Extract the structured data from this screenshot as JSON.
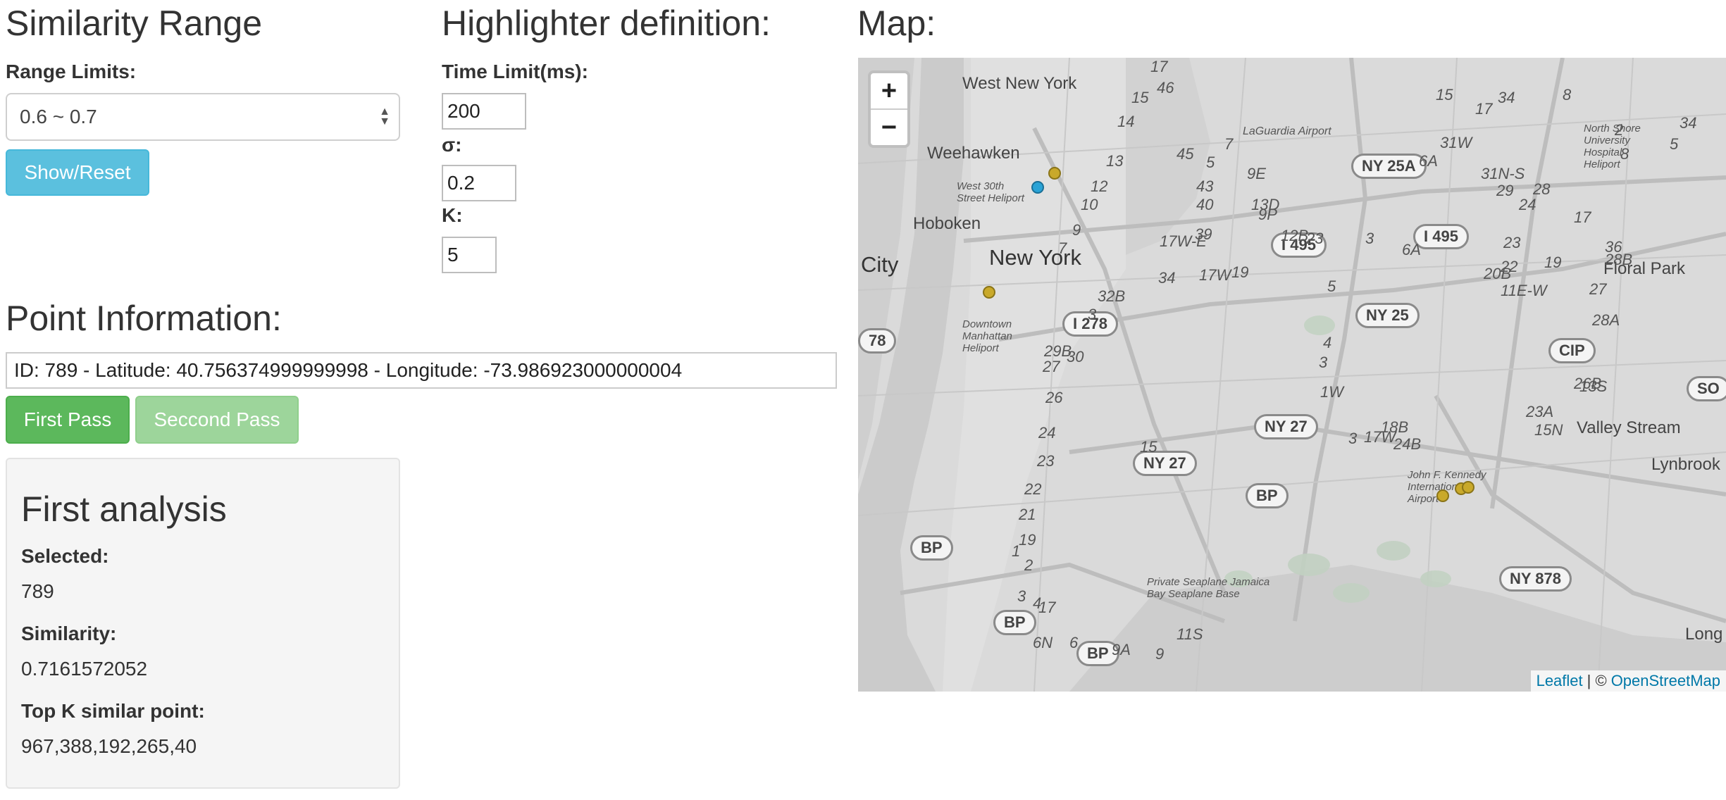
{
  "similarity": {
    "title": "Similarity Range",
    "range_label": "Range Limits:",
    "range_value": "0.6 ~ 0.7",
    "show_reset": "Show/Reset"
  },
  "highlighter": {
    "title": "Highlighter definition:",
    "time_label": "Time Limit(ms):",
    "time_value": "200",
    "sigma_label": "σ:",
    "sigma_value": "0.2",
    "k_label": "K:",
    "k_value": "5"
  },
  "point_info": {
    "title": "Point Information:",
    "text": "ID: 789 - Latitude: 40.756374999999998 - Longitude: -73.986923000000004",
    "first_pass": "First Pass",
    "second_pass": "Seccond Pass"
  },
  "analysis": {
    "title": "First analysis",
    "selected_label": "Selected:",
    "selected_value": "789",
    "similarity_label": "Similarity:",
    "similarity_value": "0.7161572052",
    "topk_label": "Top K similar point:",
    "topk_value": "967,388,192,265,40"
  },
  "map": {
    "title": "Map:",
    "zoom_in": "+",
    "zoom_out": "−",
    "attribution_leaflet": "Leaflet",
    "attribution_sep": "| ©",
    "attribution_osm": "OpenStreetMap",
    "places": {
      "west_new_york": "West New York",
      "weehawken": "Weehawken",
      "hoboken": "Hoboken",
      "city": "City",
      "new_york": "New York",
      "floral_park": "Floral Park",
      "valley_stream": "Valley Stream",
      "lynbrook": "Lynbrook",
      "long_beach": "Long Beac",
      "laguardia": "LaGuardia Airport",
      "jfk": "John F. Kennedy International Airport",
      "heliport": "West 30th Street Heliport",
      "downtown_heliport": "Downtown Manhattan Heliport",
      "jamaica_bay": "Private Seaplane Jamaica Bay Seaplane Base",
      "north_shore": "North Shore University Hospital Heliport"
    },
    "shields": {
      "ny25a": "NY 25A",
      "i495a": "I 495",
      "i495b": "I 495",
      "i278": "I 278",
      "ny25": "NY 25",
      "ny27a": "NY 27",
      "ny27b": "NY 27",
      "bp1": "BP",
      "bp2": "BP",
      "bp3": "BP",
      "bp4": "BP",
      "cip": "CIP",
      "so": "SO",
      "ny878": "NY 878",
      "r78": "78"
    },
    "exits": [
      "17",
      "46",
      "15",
      "14",
      "13",
      "12",
      "10",
      "9",
      "7",
      "45",
      "5",
      "43",
      "40",
      "39",
      "34",
      "17W-E",
      "17W",
      "19",
      "32B",
      "3",
      "29B",
      "30",
      "27",
      "26",
      "24",
      "23",
      "22",
      "21",
      "1",
      "19",
      "17",
      "2",
      "3",
      "4",
      "6",
      "6N",
      "9A",
      "9",
      "11S",
      "15",
      "7",
      "9E",
      "13D",
      "9P",
      "12B",
      "23",
      "3",
      "6A",
      "6A",
      "31W",
      "31N-S",
      "29",
      "24",
      "28",
      "23",
      "22",
      "20B",
      "17",
      "19",
      "11E-W",
      "5",
      "4",
      "3",
      "1W",
      "18B",
      "17W",
      "3",
      "24B",
      "23A",
      "15N",
      "13S",
      "26B",
      "27",
      "28A",
      "28B",
      "36",
      "34",
      "5",
      "2",
      "8",
      "15",
      "34",
      "17",
      "8"
    ],
    "markers": {
      "selected_color": "#2aa3d6",
      "similar_color": "#c9a92a"
    }
  }
}
